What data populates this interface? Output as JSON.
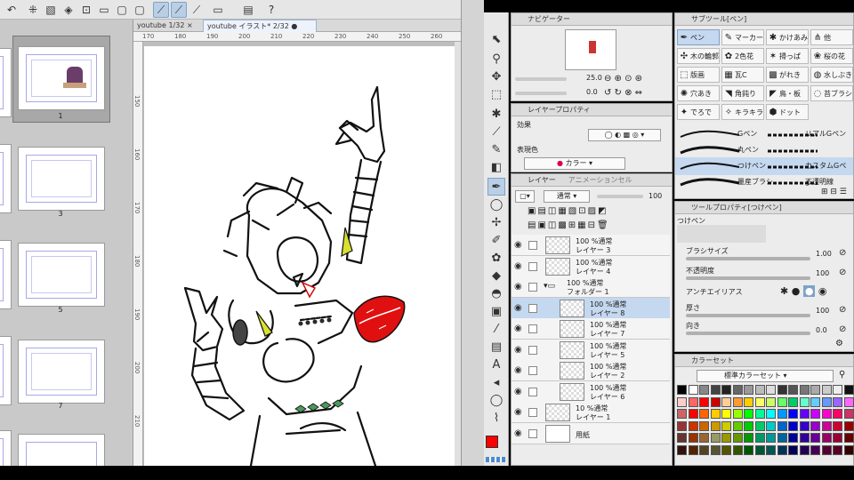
{
  "document_tabs": [
    {
      "label": "youtube",
      "counter": "1/32"
    },
    {
      "label": "youtube イラスト* 2/32"
    }
  ],
  "ruler": {
    "h_labels": [
      "170",
      "180",
      "190",
      "200",
      "210",
      "220",
      "230",
      "240",
      "250",
      "260"
    ],
    "v_labels": [
      "150",
      "160",
      "170",
      "180",
      "190",
      "200",
      "210"
    ]
  },
  "pages": [
    {
      "num": ""
    },
    {
      "num": "1"
    },
    {
      "num": ""
    },
    {
      "num": "3"
    },
    {
      "num": ""
    },
    {
      "num": "5"
    },
    {
      "num": ""
    },
    {
      "num": "7"
    },
    {
      "num": ""
    }
  ],
  "navigator": {
    "title": "ナビゲーター",
    "zoom": "25.0",
    "angle": "0.0"
  },
  "layer_property": {
    "title": "レイヤープロパティ",
    "effect_label": "効果",
    "expression_color_label": "表現色",
    "color_mode": "カラー"
  },
  "layer_panel": {
    "tabs": [
      "レイヤー",
      "アニメーションセル"
    ],
    "blend_mode": "通常",
    "opacity": "100",
    "layers": [
      {
        "top": "100 %通常",
        "name": "レイヤー 3",
        "selected": false,
        "indent": 0
      },
      {
        "top": "100 %通常",
        "name": "レイヤー 4",
        "selected": false,
        "indent": 0
      },
      {
        "top": "100 %通常",
        "name": "フォルダー 1",
        "selected": false,
        "indent": 0,
        "folder": true
      },
      {
        "top": "100 %通常",
        "name": "レイヤー 8",
        "selected": true,
        "indent": 1
      },
      {
        "top": "100 %通常",
        "name": "レイヤー 7",
        "selected": false,
        "indent": 1
      },
      {
        "top": "100 %通常",
        "name": "レイヤー 5",
        "selected": false,
        "indent": 1
      },
      {
        "top": "100 %通常",
        "name": "レイヤー 2",
        "selected": false,
        "indent": 1
      },
      {
        "top": "100 %通常",
        "name": "レイヤー 6",
        "selected": false,
        "indent": 1
      },
      {
        "top": "10 %通常",
        "name": "レイヤー 1",
        "selected": false,
        "indent": 0
      },
      {
        "top": "",
        "name": "用紙",
        "selected": false,
        "indent": 0,
        "paper": true
      }
    ]
  },
  "subtool": {
    "title": "サブツール[ペン]",
    "groups": [
      {
        "label": "ペン",
        "active": true
      },
      {
        "label": "マーカー"
      },
      {
        "label": "かけあみ"
      },
      {
        "label": "他"
      },
      {
        "label": "木の輪郭"
      },
      {
        "label": "2色花"
      },
      {
        "label": "掃っぱ"
      },
      {
        "label": "桜の花"
      },
      {
        "label": "版画"
      },
      {
        "label": "瓦C"
      },
      {
        "label": "がれき"
      },
      {
        "label": "水しぶき"
      },
      {
        "label": "穴あき"
      },
      {
        "label": "角鈍り"
      },
      {
        "label": "鳥・板"
      },
      {
        "label": "苔ブラシ"
      },
      {
        "label": "でろで"
      },
      {
        "label": "キラキラ"
      },
      {
        "label": "ドット"
      }
    ],
    "strokes": [
      {
        "left": "Gペン",
        "right": "リアルGペン"
      },
      {
        "left": "丸ペン",
        "right": ""
      },
      {
        "left": "つけペン",
        "right": "カスタムGペン",
        "active": true
      },
      {
        "left": "量産ブラシ",
        "right": "不透明線"
      }
    ]
  },
  "tool_property": {
    "title": "ツールプロパティ[つけペン]",
    "tool_name": "つけペン",
    "brush_size_label": "ブラシサイズ",
    "brush_size": "1.00",
    "opacity_label": "不透明度",
    "opacity": "100",
    "antialias_label": "アンチエイリアス",
    "thickness_label": "厚さ",
    "thickness": "100",
    "direction_label": "向き",
    "direction": "0.0"
  },
  "color_set": {
    "title": "カラーセット",
    "preset": "標準カラーセット"
  },
  "colors": {
    "accent": "#7ea2c8",
    "main_color": "#ff0000"
  }
}
